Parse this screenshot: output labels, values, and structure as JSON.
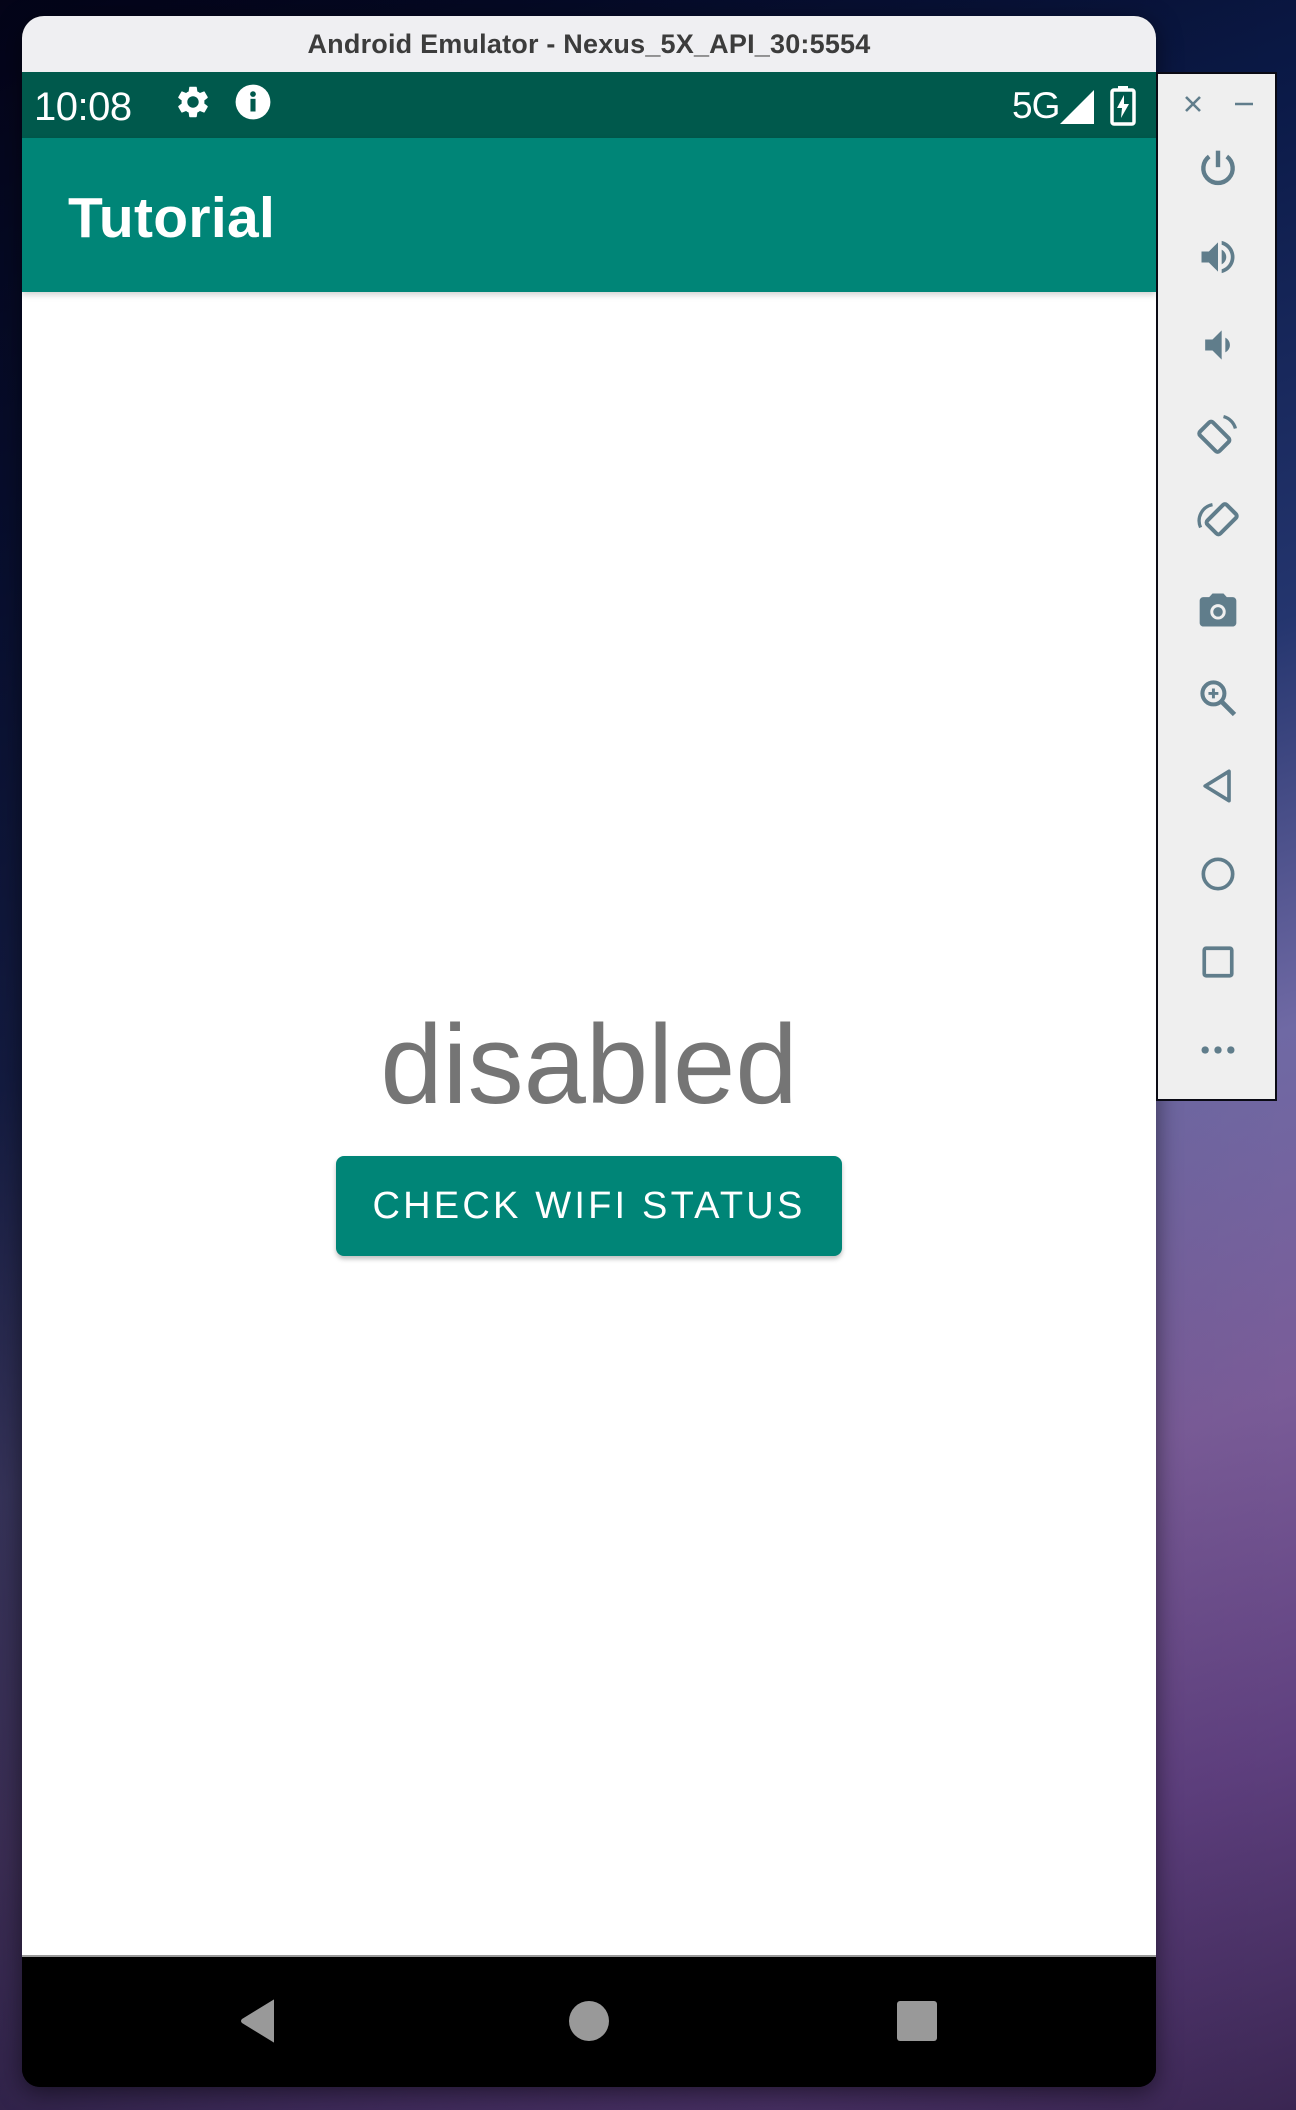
{
  "window": {
    "title": "Android Emulator - Nexus_5X_API_30:5554"
  },
  "status_bar": {
    "time": "10:08",
    "left_icons": [
      "gear-icon",
      "info-icon"
    ],
    "network": "5G",
    "right_icons": [
      "signal-icon",
      "battery-charging-icon"
    ]
  },
  "app_bar": {
    "title": "Tutorial"
  },
  "main": {
    "wifi_status_text": "disabled",
    "check_button_label": "CHECK WIFI STATUS"
  },
  "nav_bar": {
    "buttons": [
      "back",
      "home",
      "recents"
    ]
  },
  "side_panel": {
    "controls": [
      "close",
      "minimize"
    ],
    "tools": [
      {
        "name": "power",
        "label": "Power"
      },
      {
        "name": "volume-up",
        "label": "Volume up"
      },
      {
        "name": "volume-down",
        "label": "Volume down"
      },
      {
        "name": "rotate-left",
        "label": "Rotate left"
      },
      {
        "name": "rotate-right",
        "label": "Rotate right"
      },
      {
        "name": "screenshot",
        "label": "Take screenshot"
      },
      {
        "name": "zoom",
        "label": "Zoom"
      },
      {
        "name": "back",
        "label": "Back"
      },
      {
        "name": "home",
        "label": "Home"
      },
      {
        "name": "overview",
        "label": "Overview"
      },
      {
        "name": "more",
        "label": "Extended controls"
      }
    ]
  },
  "colors": {
    "primary": "#008577",
    "primary_dark": "#00594c",
    "status_text": "#757575",
    "panel_icon": "#607d8b"
  }
}
